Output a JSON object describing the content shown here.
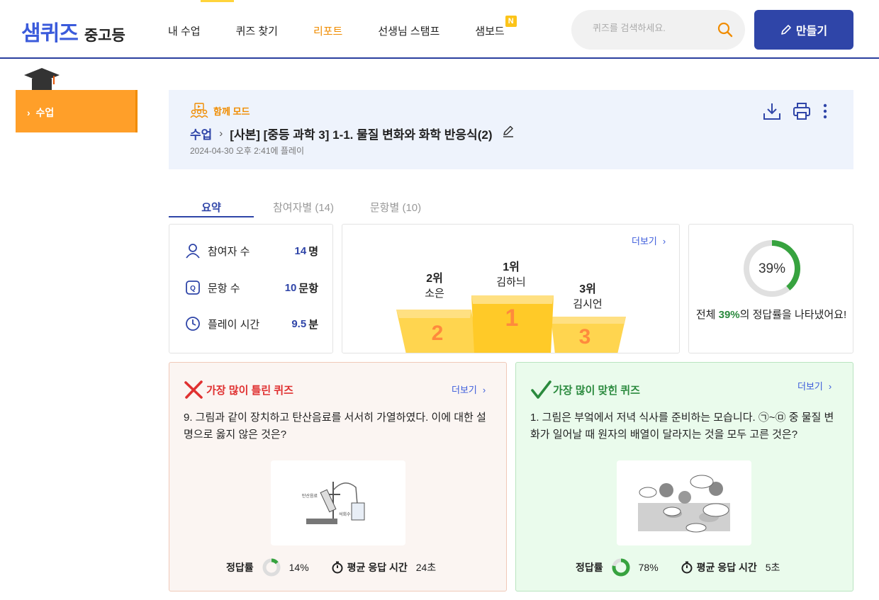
{
  "header": {
    "logo_main": "샘퀴즈",
    "logo_sub": "중고등",
    "nav": [
      "내 수업",
      "퀴즈 찾기",
      "리포트",
      "선생님 스탬프",
      "샘보드"
    ],
    "nav_badge": "N",
    "search_placeholder": "퀴즈를 검색하세요.",
    "make_label": "만들기",
    "accent": "#2f45a8"
  },
  "sidebar": {
    "item": "수업"
  },
  "banner": {
    "mode": "함께 모드",
    "breadcrumb_root": "수업",
    "breadcrumb_sep": "›",
    "title": "[사본] [중등 과학 3] 1-1. 물질 변화와 화학 반응식(2)",
    "played": "2024-04-30 오후 2:41에 플레이"
  },
  "tabs": [
    "요약",
    "참여자별 (14)",
    "문항별 (10)"
  ],
  "stats": {
    "participants_label": "참여자 수",
    "participants_value": "14",
    "participants_unit": "명",
    "questions_label": "문항 수",
    "questions_value": "10",
    "questions_unit": "문항",
    "playtime_label": "플레이 시간",
    "playtime_value": "9.5",
    "playtime_unit": "분"
  },
  "ranking": {
    "more": "더보기",
    "first_rank": "1위",
    "first_name": "김하늬",
    "second_rank": "2위",
    "second_name": "소은",
    "third_rank": "3위",
    "third_name": "김시언",
    "p1": "1",
    "p2": "2",
    "p3": "3"
  },
  "accuracy": {
    "percent_label": "39%",
    "percent": 39,
    "text_before": "전체 ",
    "text_pct": "39%",
    "text_after": "의 정답률을 나타냈어요!",
    "color": "#37a33f"
  },
  "wrong_quiz": {
    "title": "가장 많이 틀린 퀴즈",
    "more": "더보기",
    "question": "9. 그림과 같이 장치하고 탄산음료를 서서히 가열하였다. 이에 대한 설명으로 옳지 않은 것은?",
    "accuracy_label": "정답률",
    "accuracy_value": "14%",
    "accuracy": 14,
    "time_label": "평균 응답 시간",
    "time_value": "24초",
    "img_label_1": "탄산음료",
    "img_label_2": "석회수"
  },
  "right_quiz": {
    "title": "가장 많이 맞힌 퀴즈",
    "more": "더보기",
    "question": "1. 그림은 부엌에서 저녁 식사를 준비하는 모습니다. ㉠~㉤ 중 물질 변화가 일어날 때 원자의 배열이 달라지는 것을 모두 고른 것은?",
    "accuracy_label": "정답률",
    "accuracy_value": "78%",
    "accuracy": 78,
    "time_label": "평균 응답 시간",
    "time_value": "5초"
  }
}
